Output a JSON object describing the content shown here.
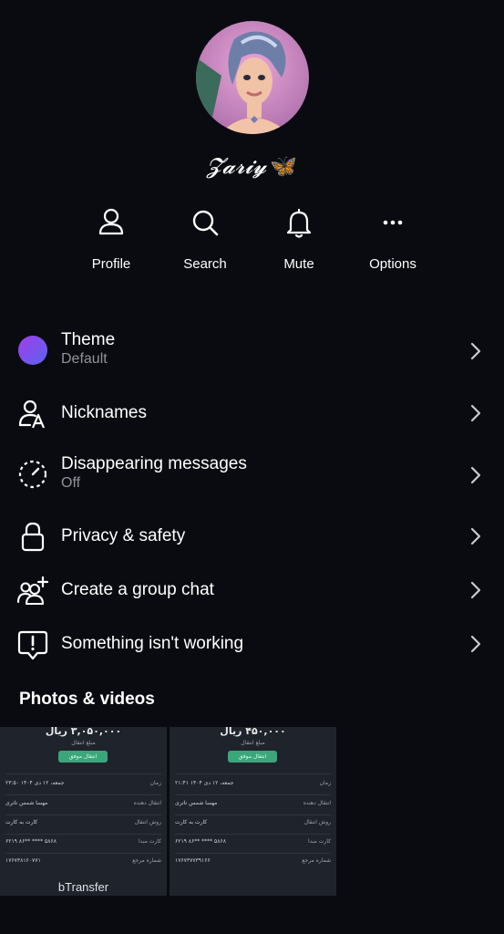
{
  "profile": {
    "name": "𝓩𝓪𝓻𝓲𝔂",
    "name_emoji": "🦋"
  },
  "actions": [
    {
      "label": "Profile",
      "icon": "person-icon"
    },
    {
      "label": "Search",
      "icon": "search-icon"
    },
    {
      "label": "Mute",
      "icon": "bell-icon"
    },
    {
      "label": "Options",
      "icon": "more-icon"
    }
  ],
  "menu": {
    "theme": {
      "title": "Theme",
      "subtitle": "Default"
    },
    "nicknames": {
      "title": "Nicknames"
    },
    "disappearing": {
      "title": "Disappearing messages",
      "subtitle": "Off"
    },
    "privacy": {
      "title": "Privacy & safety"
    },
    "group": {
      "title": "Create a group chat"
    },
    "report": {
      "title": "Something isn't working"
    }
  },
  "media": {
    "title": "Photos & videos",
    "items": [
      {
        "amount": "۳,۰۵۰,۰۰۰ ریال",
        "amount_label": "مبلغ انتقال",
        "status": "انتقال موفق",
        "rows": [
          {
            "k": "زمان",
            "v": "۲۳:۵۰ جمعه، ۱۲ دی ۱۴۰۴"
          },
          {
            "k": "انتقال دهنده",
            "v": "مهسا شمس تاتری"
          },
          {
            "k": "روش انتقال",
            "v": "کارت به کارت"
          },
          {
            "k": "کارت مبدا",
            "v": "۶۲۱۹ ۸۶** **** ۵۸۶۸"
          },
          {
            "k": "شماره مرجع",
            "v": "۱۷۶۷۳۸۱۶۰۷۷۱"
          }
        ],
        "brand": "bTransfer"
      },
      {
        "amount": "۴۵۰,۰۰۰ ریال",
        "amount_label": "مبلغ انتقال",
        "status": "انتقال موفق",
        "rows": [
          {
            "k": "زمان",
            "v": "۲۱:۴۱ جمعه، ۱۲ دی ۱۴۰۴"
          },
          {
            "k": "انتقال دهنده",
            "v": "مهسا شمس تاتری"
          },
          {
            "k": "روش انتقال",
            "v": "کارت به کارت"
          },
          {
            "k": "کارت مبدا",
            "v": "۶۲۱۹ ۸۶** **** ۵۸۶۸"
          },
          {
            "k": "شماره مرجع",
            "v": "۱۷۶۷۳۷۷۳۹۱۶۶"
          }
        ]
      }
    ]
  },
  "colors": {
    "background": "#0a0b10",
    "subtitle": "#8f9298",
    "theme_gradient_start": "#a13ee8",
    "theme_gradient_end": "#5a63f0"
  }
}
